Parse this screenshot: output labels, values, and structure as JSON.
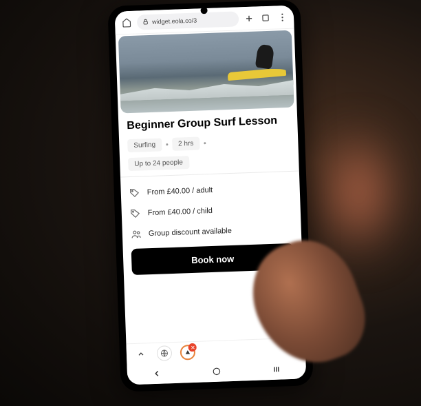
{
  "browser": {
    "url": "widget.eola.co/3"
  },
  "listing": {
    "title": "Beginner Group Surf Lesson",
    "tags": {
      "activity": "Surfing",
      "duration": "2 hrs",
      "capacity": "Up to 24 people"
    },
    "pricing": {
      "adult": "From £40.00 / adult",
      "child": "From £40.00 / child"
    },
    "discount": "Group discount available",
    "cta": "Book now"
  }
}
